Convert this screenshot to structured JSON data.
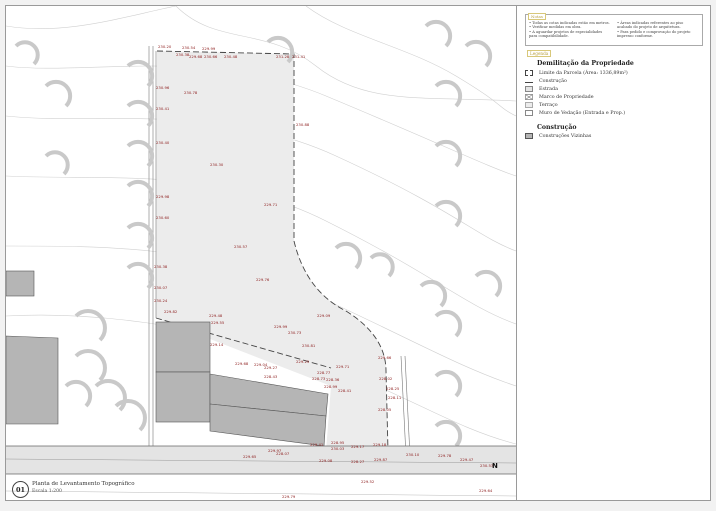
{
  "colors": {
    "label": "#8b1a1a",
    "plot_fill": "#ececec",
    "building_fill": "#b5b5b5",
    "tag_border": "#d8c87a"
  },
  "notes": {
    "tag": "Notas",
    "col1": [
      "• Todas as cotas indicadas estão em metros.",
      "• Verificar medidas em obra.",
      "• A aguardar projetos de especialidades para compatibilidade."
    ],
    "col2": [
      "• Áreas indicadas referentes ao piso acabado do projeto de arquitetura.",
      "• Para pedido e comprovação do projeto impresso conforme."
    ]
  },
  "legend": {
    "tag": "Legenda",
    "section1": "Demilitação da Propriedade",
    "section1_items": [
      "Limite da Parcela (Área: 1336,89m²)",
      "Construção",
      "Estrada",
      "Marco de Propriedade",
      "Terraço",
      "Muro de Vedação (Entrada e Prop.)"
    ],
    "section2": "Construção",
    "section2_items": [
      "Construções Vizinhas"
    ]
  },
  "title": {
    "number": "01",
    "main": "Planta de Levantamento Topográfico",
    "scale": "Escala 1:200"
  },
  "north_label": "N",
  "elevations": [
    "230.20",
    "230.54",
    "229.99",
    "230.38",
    "229.68",
    "230.66",
    "230.48",
    "231.28",
    "231.41",
    "230.96",
    "230.78",
    "230.41",
    "230.88",
    "230.40",
    "230.30",
    "229.98",
    "229.71",
    "230.60",
    "230.57",
    "230.38",
    "229.76",
    "230.07",
    "230.24",
    "229.82",
    "229.48",
    "229.55",
    "229.99",
    "230.73",
    "230.81",
    "229.14",
    "229.09",
    "229.68",
    "229.04",
    "229.27",
    "229.25",
    "229.71",
    "229.66",
    "228.77",
    "228.43",
    "228.73",
    "228.41",
    "228.02",
    "228.25",
    "228.11",
    "228.05",
    "228.36",
    "228.99",
    "228.95",
    "229.17",
    "229.18",
    "230.03",
    "229.41",
    "229.97",
    "229.65",
    "228.07",
    "229.08",
    "228.27",
    "229.87",
    "230.10",
    "229.78",
    "229.47",
    "230.53",
    "229.52",
    "229.64",
    "229.79"
  ]
}
